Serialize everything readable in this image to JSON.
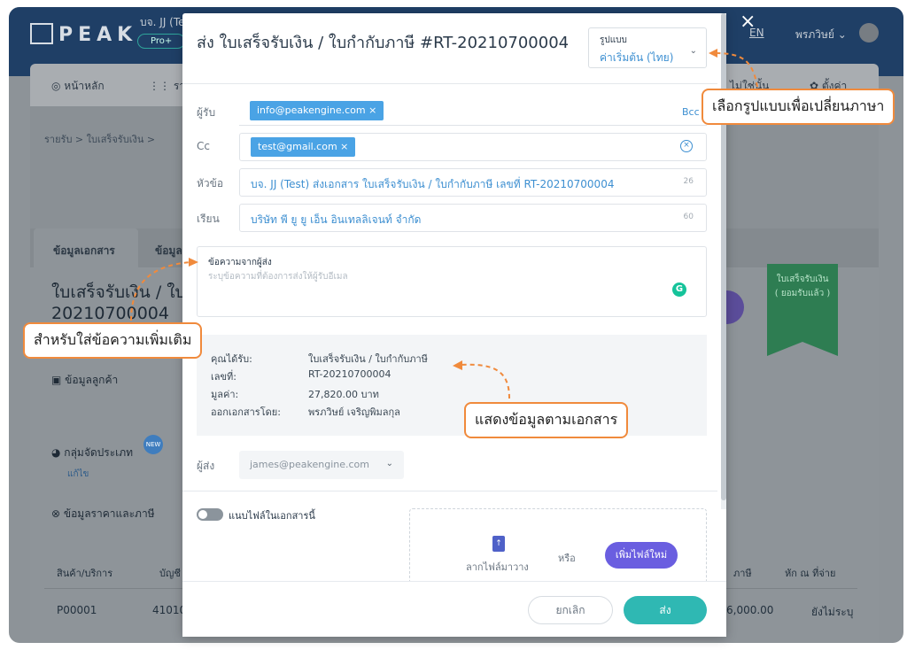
{
  "app": {
    "logo": "PEAK",
    "company": "บจ. JJ (Te",
    "plan": "Pro+",
    "lang": "EN",
    "user": "พรภวิษย์ ⌄"
  },
  "nav": {
    "home": "หน้าหลัก",
    "report": "ราย",
    "right1": "ไม่ใช่นั้น",
    "settings": "ตั้งค่า"
  },
  "breadcrumb": "รายรับ  >  ใบเสร็จรับเงิน  >",
  "tabs": {
    "doc": "ข้อมูลเอกสาร",
    "other": "ข้อมูล"
  },
  "doc_title_line1": "ใบเสร็จรับเงิน / ใบ",
  "doc_title_line2": "20210700004",
  "sections": {
    "customer": "ข้อมูลลูกค้า",
    "group": "กลุ่มจัดประเภท",
    "group_edit": "แก้ไข",
    "pricing": "ข้อมูลราคาและภาษี"
  },
  "new_badge": "NEW",
  "ribbon": "ใบเสร็จรับเงิน\n( ยอมรับแล้ว )",
  "table": {
    "h_item": "สินค้า/บริการ",
    "h_acc": "บัญชี",
    "h_tax": "ภาษี",
    "h_wht": "หัก ณ ที่จ่าย",
    "r_item": "P00001",
    "r_acc": "41010",
    "r_amount": "6,000.00",
    "r_wht": "ยังไม่ระบุ"
  },
  "modal": {
    "title": "ส่ง ใบเสร็จรับเงิน / ใบกำกับภาษี #RT-20210700004",
    "close": "×",
    "format_label": "รูปแบบ",
    "format_value": "ค่าเริ่มต้น (ไทย)",
    "to_label": "ผู้รับ",
    "to_chip": "info@peakengine.com",
    "bcc": "Bcc",
    "cc_label": "Cc",
    "cc_chip": "test@gmail.com",
    "subject_label": "หัวข้อ",
    "subject_value": "บจ. JJ (Test) ส่งเอกสาร ใบเสร็จรับเงิน / ใบกำกับภาษี เลขที่ RT-20210700004",
    "subject_count": "26",
    "dear_label": "เรียน",
    "dear_value": "บริษัท พี ยู ยู เอ็น อินเทลลิเจนท์ จำกัด",
    "dear_count": "60",
    "message_label": "ข้อความจากผู้ส่ง",
    "message_placeholder": "ระบุข้อความที่ต้องการส่งให้ผู้รับอีเมล",
    "info": [
      {
        "label": "คุณได้รับ:",
        "value": "ใบเสร็จรับเงิน / ใบกำกับภาษี"
      },
      {
        "label": "เลขที่:",
        "value": "RT-20210700004"
      },
      {
        "label": "มูลค่า:",
        "value": "27,820.00 บาท"
      },
      {
        "label": "ออกเอกสารโดย:",
        "value": "พรภวิษย์ เจริญพิมลกุล"
      }
    ],
    "sender_label": "ผู้ส่ง",
    "sender_value": "james@peakengine.com",
    "attach_label": "แนบไฟล์ในเอกสารนี้",
    "drop_text": "ลากไฟล์มาวาง",
    "or_text": "หรือ",
    "add_file": "เพิ่มไฟล์ใหม่",
    "cancel": "ยกเลิก",
    "send": "ส่ง"
  },
  "callouts": {
    "format": "เลือกรูปแบบเพื่อเปลี่ยนภาษา",
    "message": "สำหรับใส่ข้อความเพิ่มเติม",
    "info": "แสดงข้อมูลตามเอกสาร"
  },
  "colors": {
    "accent": "#3d8fd1",
    "send": "#2fb8b3",
    "addfile": "#6a5ee0",
    "callout_border": "#f08a3c"
  }
}
